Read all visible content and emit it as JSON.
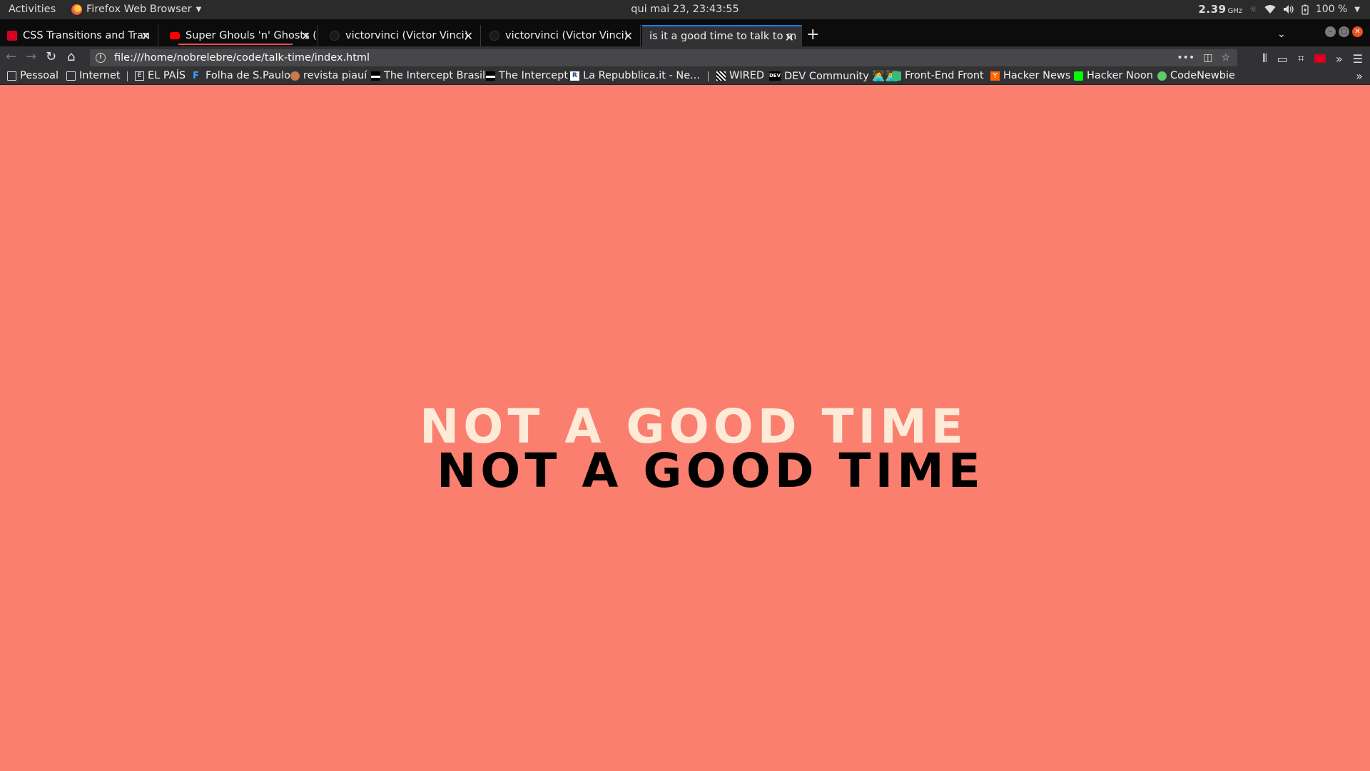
{
  "os": {
    "activities": "Activities",
    "app_menu": "Firefox Web Browser",
    "clock": "qui mai 23, 23:43:55",
    "cpu_freq": "2.39",
    "cpu_unit": "GHz",
    "battery": "100 %"
  },
  "tabs": [
    {
      "title": "CSS Transitions and Tran",
      "icon_color": "#d70022"
    },
    {
      "title": "Super Ghouls 'n' Ghosts (",
      "icon_color": "#ff0000"
    },
    {
      "title": "victorvinci (Victor Vinci)",
      "icon_color": "#24292e"
    },
    {
      "title": "victorvinci (Victor Vinci)",
      "icon_color": "#24292e"
    },
    {
      "title": "is it a good time to talk to m",
      "icon_color": ""
    }
  ],
  "navbar": {
    "url": "file:///home/nobrelebre/code/talk-time/index.html"
  },
  "bookmarks": [
    {
      "label": "Pessoal"
    },
    {
      "label": "Internet"
    },
    {
      "label": "EL PAÍS"
    },
    {
      "label": "Folha de S.Paulo"
    },
    {
      "label": "revista piauí"
    },
    {
      "label": "The Intercept Brasil"
    },
    {
      "label": "The Intercept"
    },
    {
      "label": "La Repubblica.it - Ne..."
    },
    {
      "label": "WIRED"
    },
    {
      "label": "DEV Community 👩‍💻👨‍💻"
    },
    {
      "label": "Front-End Front"
    },
    {
      "label": "Hacker News"
    },
    {
      "label": "Hacker Noon"
    },
    {
      "label": "CodeNewbie"
    }
  ],
  "page": {
    "headline_light": "NOT A GOOD TIME",
    "headline_dark": "NOT A GOOD TIME",
    "background": "#fa7f6f"
  }
}
